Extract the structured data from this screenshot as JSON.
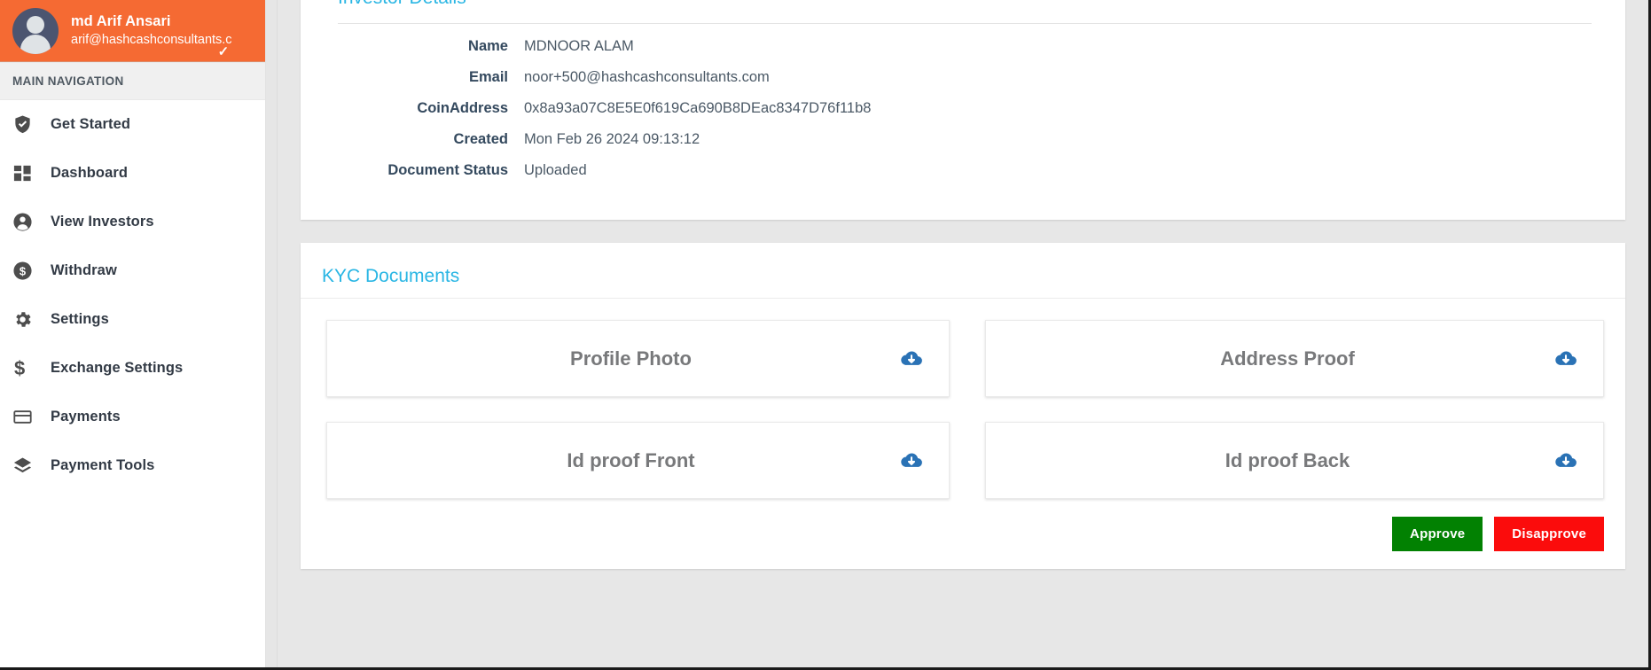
{
  "sidebar": {
    "user": {
      "name": "md Arif Ansari",
      "email": "arif@hashcashconsultants.c",
      "avatar_icon": "user-avatar-icon",
      "caret_icon": "chevron-down-icon"
    },
    "nav_header": "MAIN NAVIGATION",
    "items": [
      {
        "label": "Get Started",
        "icon": "shield-check-icon"
      },
      {
        "label": "Dashboard",
        "icon": "dashboard-grid-icon"
      },
      {
        "label": "View Investors",
        "icon": "user-circle-icon"
      },
      {
        "label": "Withdraw",
        "icon": "dollar-circle-icon"
      },
      {
        "label": "Settings",
        "icon": "gear-icon"
      },
      {
        "label": "Exchange Settings",
        "icon": "dollar-sign-icon"
      },
      {
        "label": "Payments",
        "icon": "credit-card-icon"
      },
      {
        "label": "Payment Tools",
        "icon": "layers-icon"
      }
    ]
  },
  "investor_details": {
    "title": "Investor Details",
    "rows": [
      {
        "label": "Name",
        "value": "MDNOOR ALAM"
      },
      {
        "label": "Email",
        "value": "noor+500@hashcashconsultants.com"
      },
      {
        "label": "CoinAddress",
        "value": "0x8a93a07C8E5E0f619Ca690B8DEac8347D76f11b8"
      },
      {
        "label": "Created",
        "value": "Mon Feb 26 2024 09:13:12"
      },
      {
        "label": "Document Status",
        "value": "Uploaded"
      }
    ]
  },
  "kyc_documents": {
    "title": "KYC Documents",
    "documents": [
      {
        "label": "Profile Photo",
        "download_icon": "cloud-download-icon"
      },
      {
        "label": "Address Proof",
        "download_icon": "cloud-download-icon"
      },
      {
        "label": "Id proof Front",
        "download_icon": "cloud-download-icon"
      },
      {
        "label": "Id proof Back",
        "download_icon": "cloud-download-icon"
      }
    ],
    "actions": {
      "approve_label": "Approve",
      "disapprove_label": "Disapprove"
    }
  },
  "colors": {
    "brand_orange": "#f56a33",
    "title_cyan": "#2ab6e4",
    "approve_green": "#028102",
    "disapprove_red": "#fb0c0c",
    "download_blue": "#2a72b5"
  }
}
